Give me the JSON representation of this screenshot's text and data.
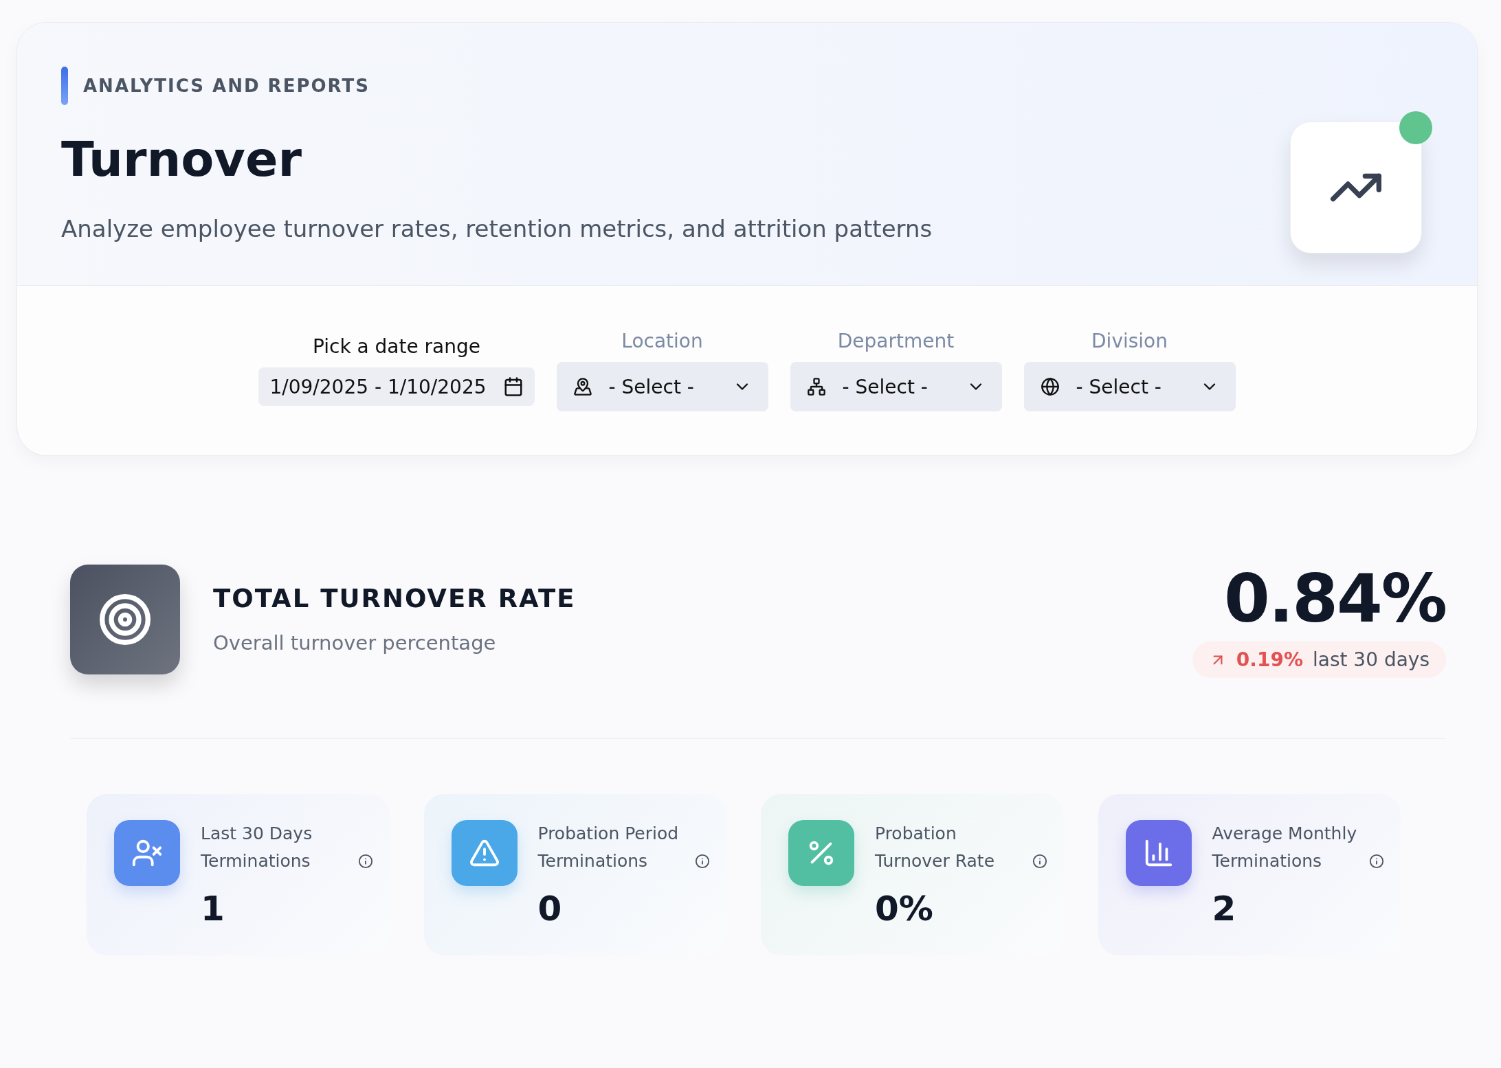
{
  "header": {
    "eyebrow": "ANALYTICS AND REPORTS",
    "title": "Turnover",
    "subtitle": "Analyze employee turnover rates, retention metrics, and attrition patterns",
    "status_online": true
  },
  "filters": {
    "date": {
      "label": "Pick a date range",
      "value": "1/09/2025 - 1/10/2025"
    },
    "selects": [
      {
        "kind": "location",
        "label": "Location",
        "value": "- Select -"
      },
      {
        "kind": "department",
        "label": "Department",
        "value": "- Select -"
      },
      {
        "kind": "division",
        "label": "Division",
        "value": "- Select -"
      }
    ]
  },
  "total": {
    "title": "TOTAL TURNOVER RATE",
    "subtitle": "Overall turnover percentage",
    "value": "0.84%",
    "change": "0.19%",
    "period": "last 30 days"
  },
  "stats": [
    {
      "kind": "user-x",
      "color": "#5b8def",
      "label": "Last 30 Days Terminations",
      "value": "1"
    },
    {
      "kind": "warning",
      "color": "#4aa8e8",
      "label": "Probation Period Terminations",
      "value": "0"
    },
    {
      "kind": "percent",
      "color": "#52bfa2",
      "label": "Probation Turnover Rate",
      "value": "0%"
    },
    {
      "kind": "bars",
      "color": "#6b6ee8",
      "label": "Average Monthly Terminations",
      "value": "2"
    }
  ]
}
